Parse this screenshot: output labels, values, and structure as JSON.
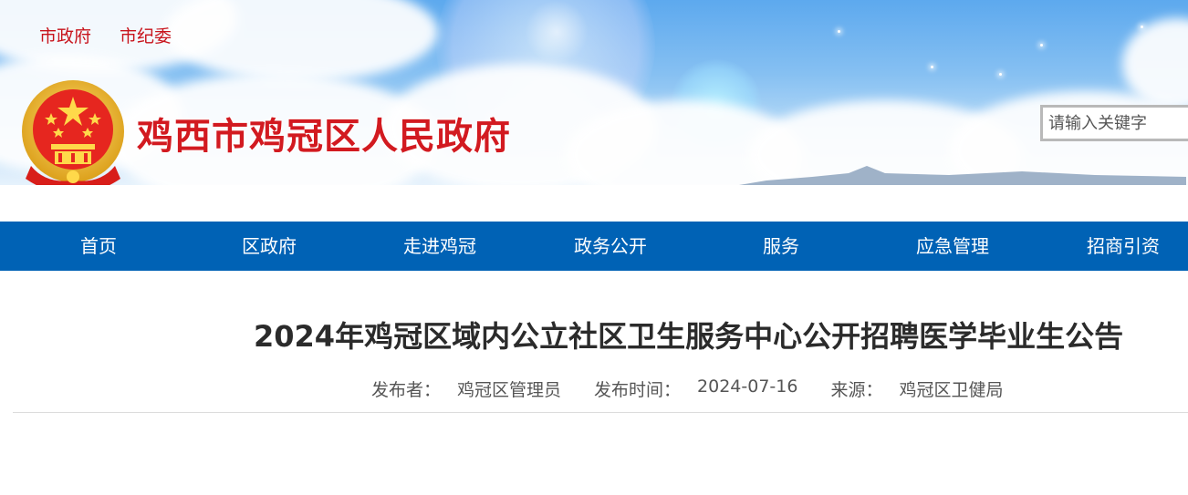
{
  "top_links": [
    "市政府",
    "市纪委"
  ],
  "site_title": "鸡西市鸡冠区人民政府",
  "search": {
    "placeholder": "请输入关键字"
  },
  "nav": [
    "首页",
    "区政府",
    "走进鸡冠",
    "政务公开",
    "服务",
    "应急管理",
    "招商引资"
  ],
  "article": {
    "title": "2024年鸡冠区域内公立社区卫生服务中心公开招聘医学毕业生公告",
    "meta": {
      "publisher_label": "发布者：",
      "publisher": "鸡冠区管理员",
      "time_label": "发布时间：",
      "time": "2024-07-16",
      "source_label": "来源：",
      "source": "鸡冠区卫健局"
    }
  },
  "colors": {
    "nav_bg": "#0062b5",
    "title_red": "#d21a20",
    "link_red": "#c8141c"
  },
  "icons": {
    "emblem": "national-emblem-icon"
  }
}
